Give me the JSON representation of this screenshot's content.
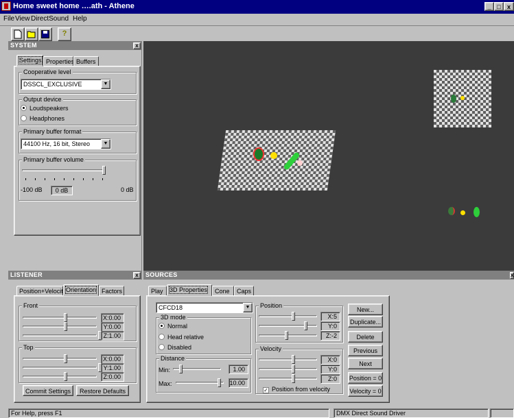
{
  "window": {
    "title": "Home sweet home ….ath - Athene",
    "min": "_",
    "max": "□",
    "close": "x"
  },
  "menu": {
    "file": "File",
    "view": "View",
    "directsound": "DirectSound",
    "help": "Help"
  },
  "toolbar": {
    "new_icon": "new-document-icon",
    "open_icon": "open-folder-icon",
    "save_icon": "save-disk-icon",
    "help_icon": "help-question-icon"
  },
  "system": {
    "title": "SYSTEM",
    "close": "x",
    "tabs": [
      "Settings",
      "Properties",
      "Buffers"
    ],
    "cooperative_label": "Cooperative level",
    "cooperative_value": "DSSCL_EXCLUSIVE",
    "output_label": "Output device",
    "output_options": [
      "Loudspeakers",
      "Headphones"
    ],
    "format_label": "Primary buffer format",
    "format_value": "44100 Hz, 16 bit, Stereo",
    "volume_label": "Primary buffer volume",
    "volume_min": "-100 dB",
    "volume_value": "0 dB",
    "volume_max": "0 dB",
    "volume_fraction": 1.0
  },
  "listener": {
    "title": "LISTENER",
    "close": "x",
    "tabs": [
      "Position+Velocity",
      "Orientation",
      "Factors"
    ],
    "front_label": "Front",
    "front": [
      "X:0.00",
      "Y:0.00",
      "Z:1.00"
    ],
    "top_label": "Top",
    "top": [
      "X:0.00",
      "Y:1.00",
      "Z:0.00"
    ],
    "commit": "Commit Settings",
    "restore": "Restore Defaults"
  },
  "sources": {
    "title": "SOURCES",
    "close": "x",
    "tabs": [
      "Play",
      "3D Properties",
      "Cone",
      "Caps"
    ],
    "source_value": "CFCD18",
    "mode_label": "3D mode",
    "modes": [
      "Normal",
      "Head relative",
      "Disabled"
    ],
    "distance_label": "Distance",
    "min_label": "Min:",
    "min_value": "1.00",
    "max_label": "Max:",
    "max_value": "10.00",
    "position_label": "Position",
    "position": [
      "X:5",
      "Y:0",
      "Z:-2"
    ],
    "velocity_label": "Velocity",
    "velocity": [
      "X:0",
      "Y:0",
      "Z:0"
    ],
    "from_velocity": "Position from velocity",
    "buttons": [
      "New...",
      "Duplicate...",
      "Delete",
      "Previous",
      "Next",
      "Position = 0",
      "Velocity = 0"
    ]
  },
  "status": {
    "help": "For Help, press F1",
    "driver": "DMX Direct Sound Driver"
  },
  "colors": {
    "titlebar": "#000080",
    "panel_title": "#808080",
    "viewport": "#3b3b3b"
  }
}
